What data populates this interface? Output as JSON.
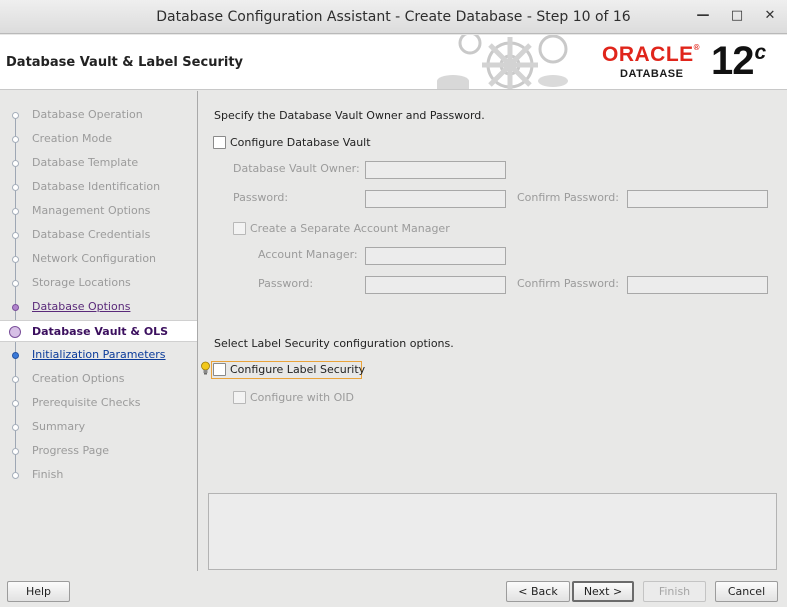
{
  "window": {
    "title": "Database Configuration Assistant - Create Database - Step 10 of 16",
    "minimize_glyph": "—",
    "maximize_glyph": "□",
    "close_glyph": "✕"
  },
  "header": {
    "page_title": "Database Vault & Label Security",
    "oracle_logo": "ORACLE",
    "oracle_reg": "®",
    "database_word": "DATABASE",
    "version_number": "12",
    "version_letter": "c"
  },
  "sidebar": {
    "items": [
      {
        "label": "Database Operation",
        "state": "pending"
      },
      {
        "label": "Creation Mode",
        "state": "pending"
      },
      {
        "label": "Database Template",
        "state": "pending"
      },
      {
        "label": "Database Identification",
        "state": "pending"
      },
      {
        "label": "Management Options",
        "state": "pending"
      },
      {
        "label": "Database Credentials",
        "state": "pending"
      },
      {
        "label": "Network Configuration",
        "state": "pending"
      },
      {
        "label": "Storage Locations",
        "state": "pending"
      },
      {
        "label": "Database Options",
        "state": "done"
      },
      {
        "label": "Database Vault & OLS",
        "state": "current"
      },
      {
        "label": "Initialization Parameters",
        "state": "next"
      },
      {
        "label": "Creation Options",
        "state": "pending"
      },
      {
        "label": "Prerequisite Checks",
        "state": "pending"
      },
      {
        "label": "Summary",
        "state": "pending"
      },
      {
        "label": "Progress Page",
        "state": "pending"
      },
      {
        "label": "Finish",
        "state": "pending"
      }
    ]
  },
  "vault": {
    "instruction": "Specify the Database Vault Owner and Password.",
    "configure_label": "Configure Database Vault",
    "configure_checked": false,
    "owner_label": "Database Vault Owner:",
    "owner_value": "",
    "password_label": "Password:",
    "password_value": "",
    "confirm_label": "Confirm Password:",
    "confirm_value": "",
    "separate_manager_label": "Create a Separate Account Manager",
    "separate_manager_checked": false,
    "account_manager_label": "Account Manager:",
    "account_manager_value": "",
    "am_password_label": "Password:",
    "am_password_value": "",
    "am_confirm_label": "Confirm Password:",
    "am_confirm_value": ""
  },
  "label_security": {
    "instruction": "Select Label Security configuration options.",
    "configure_label": "Configure Label Security",
    "configure_checked": false,
    "oid_label": "Configure with OID",
    "oid_checked": false
  },
  "messages": {
    "text": ""
  },
  "footer": {
    "help": "Help",
    "back": "< Back",
    "next": "Next >",
    "finish": "Finish",
    "cancel": "Cancel"
  },
  "colors": {
    "oracle_red": "#e0251b",
    "current_step": "#3b0f5e",
    "link_blue": "#0b3b9a",
    "hint_yellow": "#f2c81b"
  }
}
